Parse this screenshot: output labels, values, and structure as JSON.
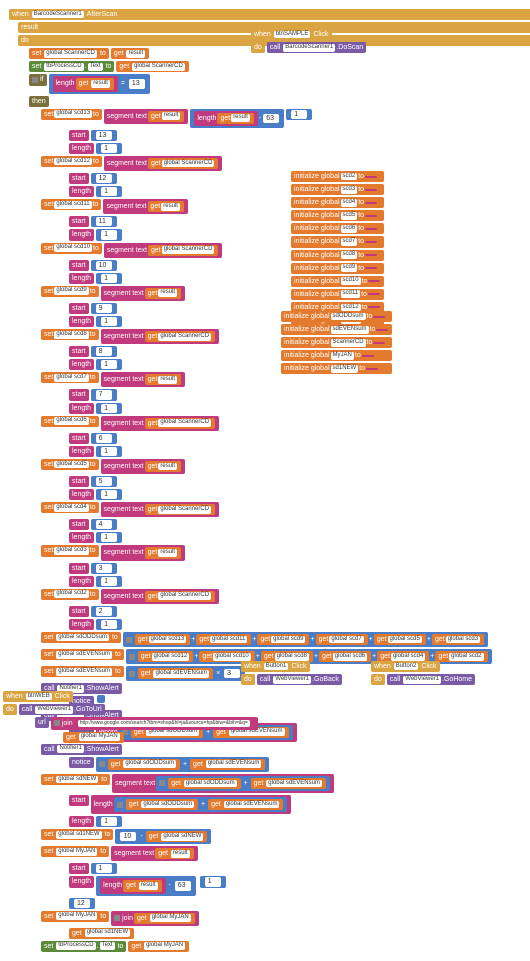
{
  "events": {
    "afterscan": {
      "component": "BarcodeScanner1",
      "event": "AfterScan",
      "param": "result"
    },
    "btnSample": {
      "component": "btnSAMPLE",
      "event": "Click"
    },
    "btn1": {
      "component": "Button1",
      "event": "Click"
    },
    "btn2": {
      "component": "Button2",
      "event": "Click"
    },
    "btnWeb": {
      "component": "btnWEB",
      "event": "Click"
    }
  },
  "vars": {
    "scannerCD": "global ScannerCD",
    "txtProcess": "tbProcessCD",
    "text": "Text",
    "sdODD": "global sdODDsum",
    "sdEVEN": "global sdEVENsum",
    "sdNEW": "global sdNEW",
    "sd1NEW": "global sd1NEW",
    "myJAN": "global MyJAN"
  },
  "scdVars": [
    "global scd13",
    "global scd12",
    "global scd11",
    "global scd10",
    "global scd9",
    "global scd8",
    "global scd7",
    "global scd6",
    "global scd5",
    "global scd4",
    "global scd3",
    "global scd2"
  ],
  "initVars": [
    "scd2",
    "scd3",
    "scd4",
    "scd5",
    "scd6",
    "scd7",
    "scd8",
    "scd9",
    "scd10",
    "scd11",
    "scd12",
    "scd13"
  ],
  "initExtra": [
    "sdODDsum",
    "sdEVENsum",
    "ScannerCD",
    "MyJAN",
    "sd1NEW"
  ],
  "ops": {
    "set": "set",
    "get": "get",
    "to": "to",
    "call": "call",
    "join": "join",
    "segment": "segment text",
    "start": "start",
    "length": "length",
    "if": "if",
    "then": "then",
    "do": "do",
    "when": "when",
    "initGlobal": "initialize global",
    "showAlert": "ShowAlert",
    "notice": "notice",
    "goToUrl": "GoToUrl",
    "url": "url",
    "goBack": "GoBack",
    "goHome": "GoHome",
    "doScan": "DoScan",
    "result": "result",
    "notifier": "Notifier1",
    "webviewer": "WebViewer1",
    "barcode": "BarcodeScanner1"
  },
  "nums": {
    "n1": "1",
    "n2": "2",
    "n3": "3",
    "n4": "4",
    "n5": "5",
    "n6": "6",
    "n7": "7",
    "n8": "8",
    "n9": "9",
    "n10": "10",
    "n11": "11",
    "n12": "12",
    "n13": "13",
    "n63": "63"
  },
  "litEmpty": " ",
  "url": "http://www.google.com/search?tbm=shop&hl=ja&source=hp&biw=&bih=&q=",
  "oddList": [
    "global scd13",
    "global scd11",
    "global scd9",
    "global scd7",
    "global scd5",
    "global scd3"
  ],
  "evenList": [
    "global scd12",
    "global scd10",
    "global scd8",
    "global scd6",
    "global scd4",
    "global scd2"
  ]
}
